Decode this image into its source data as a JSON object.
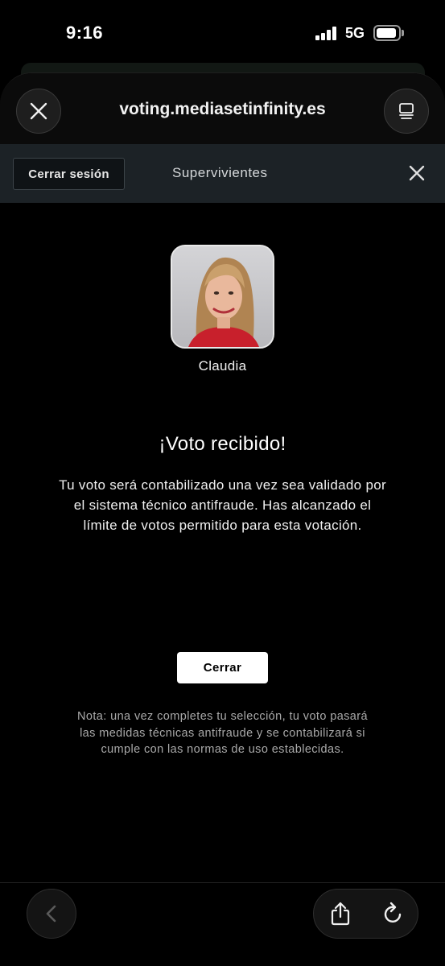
{
  "status_bar": {
    "time": "9:16",
    "network": "5G",
    "icons": [
      "signal-icon",
      "battery-icon"
    ]
  },
  "browser": {
    "url": "voting.mediasetinfinity.es",
    "icons": [
      "close-icon",
      "tabs-icon",
      "back-icon",
      "share-icon",
      "reload-icon"
    ]
  },
  "site_header": {
    "logout_label": "Cerrar sesión",
    "title": "Supervivientes",
    "icons": [
      "close-icon"
    ]
  },
  "candidate": {
    "name": "Claudia"
  },
  "confirmation": {
    "title": "¡Voto recibido!",
    "message": "Tu voto será contabilizado una vez sea validado por el sistema técnico antifraude. Has alcanzado el límite de votos permitido para esta votación.",
    "close_label": "Cerrar",
    "note": "Nota: una vez completes tu selección, tu voto pasará las medidas técnicas antifraude y se contabilizará si cumple con las normas de uso establecidas."
  },
  "colors": {
    "background": "#000000",
    "site_header": "#1c2226",
    "button_primary": "#ffffff",
    "muted_text": "#a9a9a9"
  }
}
